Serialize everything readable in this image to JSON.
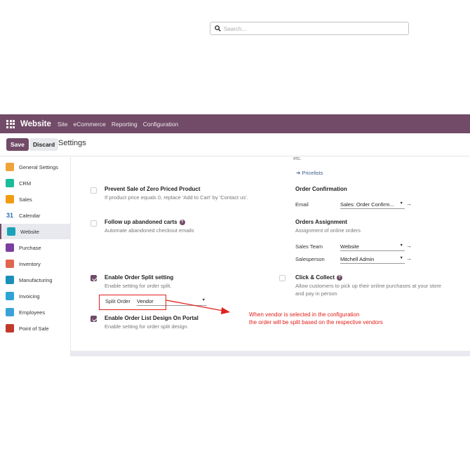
{
  "navbar": {
    "brand": "Website",
    "items": [
      "Site",
      "eCommerce",
      "Reporting",
      "Configuration"
    ]
  },
  "controlbar": {
    "save_label": "Save",
    "discard_label": "Discard",
    "title": "Settings",
    "search_placeholder": "Search..."
  },
  "sidebar": {
    "items": [
      {
        "label": "General Settings",
        "icon": "gear-icon",
        "color": "#f0a33a"
      },
      {
        "label": "CRM",
        "icon": "crm-icon",
        "color": "#1abc9c"
      },
      {
        "label": "Sales",
        "icon": "sales-chart-icon",
        "color": "#f39c12"
      },
      {
        "label": "Calendar",
        "icon": "calendar-icon",
        "color": "#2e6db4"
      },
      {
        "label": "Website",
        "icon": "globe-icon",
        "color": "#1aa3b8",
        "active": true
      },
      {
        "label": "Purchase",
        "icon": "purchase-icon",
        "color": "#7b3fa0"
      },
      {
        "label": "Inventory",
        "icon": "inventory-box-icon",
        "color": "#e0664f"
      },
      {
        "label": "Manufacturing",
        "icon": "manufacturing-icon",
        "color": "#1a8fb8"
      },
      {
        "label": "Invoicing",
        "icon": "invoice-icon",
        "color": "#2ea3d6"
      },
      {
        "label": "Employees",
        "icon": "employees-icon",
        "color": "#3aa2d8"
      },
      {
        "label": "Point of Sale",
        "icon": "pos-icon",
        "color": "#c0392b"
      }
    ]
  },
  "left": {
    "prevent_zero": {
      "title": "Prevent Sale of Zero Priced Product",
      "desc": "If product price equals 0, replace 'Add to Cart' by 'Contact us'."
    },
    "abandoned": {
      "title": "Follow up abandoned carts",
      "desc": "Automate abandoned checkout emails"
    },
    "order_split": {
      "title": "Enable Order Split setting",
      "desc": "Enable setting for order split.",
      "field_label": "Split Order",
      "field_value": "Vendor"
    },
    "order_list": {
      "title": "Enable Order List Design On Portal",
      "desc": "Enable setting for order split design."
    }
  },
  "right": {
    "etc_text": "etc.",
    "pricelists_link": "Pricelists",
    "order_confirmation": {
      "title": "Order Confirmation",
      "email_label": "Email",
      "email_value": "Sales: Order Confirm..."
    },
    "orders_assignment": {
      "title": "Orders Assignment",
      "desc": "Assignment of online orders",
      "team_label": "Sales Team",
      "team_value": "Website",
      "person_label": "Salesperson",
      "person_value": "Mitchell Admin"
    },
    "click_collect": {
      "title": "Click & Collect",
      "desc_line1": "Allow customers to pick up their online purchases at your store",
      "desc_line2": "and pay in person"
    }
  },
  "annotation": {
    "line1": "When vendor is selected in the configuration",
    "line2": "the order will be split based on the respective vendors",
    "color": "#e0201a"
  }
}
